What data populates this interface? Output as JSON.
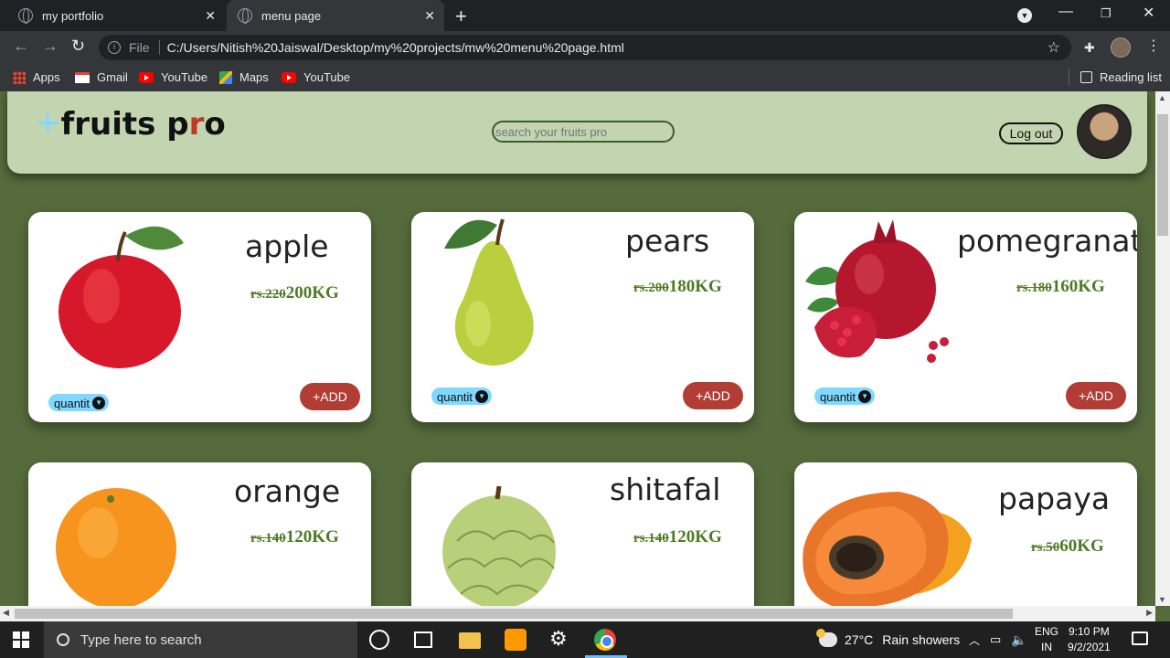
{
  "browser": {
    "tabs": [
      {
        "title": "my portfolio",
        "active": false
      },
      {
        "title": "menu page",
        "active": true
      }
    ],
    "address": {
      "scheme_label": "File",
      "url": "C:/Users/Nitish%20Jaiswal/Desktop/my%20projects/mw%20menu%20page.html"
    },
    "bookmarks": [
      {
        "label": "Apps",
        "icon": "apps-grid-icon"
      },
      {
        "label": "Gmail",
        "icon": "gmail-icon"
      },
      {
        "label": "YouTube",
        "icon": "youtube-icon"
      },
      {
        "label": "Maps",
        "icon": "maps-icon"
      },
      {
        "label": "YouTube",
        "icon": "youtube-icon"
      }
    ],
    "reading_list": "Reading list"
  },
  "page": {
    "logo": {
      "plus": "+",
      "part1": "fruits p",
      "r": "r",
      "part2": "o"
    },
    "search_placeholder": "search your fruits pro",
    "logout_label": "Log out",
    "colors": {
      "background": "#556b3c",
      "header": "#c2d4b0",
      "price": "#4f7a24",
      "add_button": "#b13d35",
      "quantity_select": "#7fd8ff"
    },
    "products": [
      {
        "name": "apple",
        "old_price": "rs.220",
        "new_price": "200KG",
        "quantity_label": "quantit",
        "add_label": "+ADD"
      },
      {
        "name": "pears",
        "old_price": "rs.200",
        "new_price": "180KG",
        "quantity_label": "quantit",
        "add_label": "+ADD"
      },
      {
        "name": "pomegranate",
        "old_price": "rs.180",
        "new_price": "160KG",
        "quantity_label": "quantit",
        "add_label": "+ADD"
      },
      {
        "name": "orange",
        "old_price": "rs.140",
        "new_price": "120KG"
      },
      {
        "name": "shitafal",
        "old_price": "rs.140",
        "new_price": "120KG"
      },
      {
        "name": "papaya",
        "old_price": "rs.50",
        "new_price": "60KG"
      }
    ]
  },
  "taskbar": {
    "search_placeholder": "Type here to search",
    "weather": {
      "temp": "27°C",
      "desc": "Rain showers"
    },
    "lang": {
      "line1": "ENG",
      "line2": "IN"
    },
    "clock": {
      "time": "9:10 PM",
      "date": "9/2/2021"
    }
  }
}
